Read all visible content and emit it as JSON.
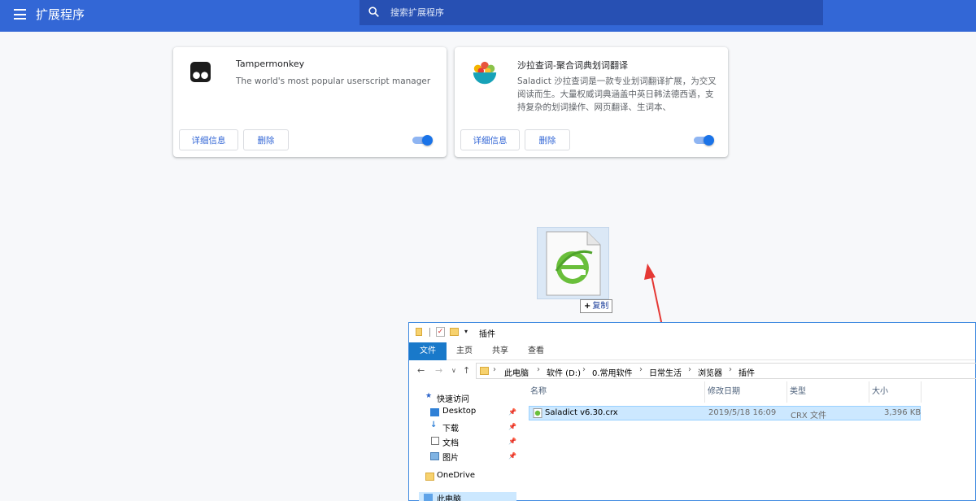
{
  "header": {
    "title": "扩展程序",
    "search_placeholder": "搜索扩展程序"
  },
  "extensions": [
    {
      "name": "Tampermonkey",
      "description": "The world's most popular userscript manager",
      "details_label": "详细信息",
      "remove_label": "删除",
      "enabled": true,
      "icon": "tampermonkey-icon"
    },
    {
      "name": "沙拉查词-聚合词典划词翻译",
      "description": "Saladict 沙拉查词是一款专业划词翻译扩展，为交叉阅读而生。大量权威词典涵盖中英日韩法德西语，支持复杂的划词操作、网页翻译、生词本、",
      "details_label": "详细信息",
      "remove_label": "删除",
      "enabled": true,
      "icon": "saladict-icon"
    }
  ],
  "drag": {
    "badge_label": "复制",
    "file_icon": "crx-file-icon"
  },
  "explorer": {
    "title": "插件",
    "ribbon_tabs": [
      "文件",
      "主页",
      "共享",
      "查看"
    ],
    "breadcrumb": [
      "此电脑",
      "软件 (D:)",
      "0.常用软件",
      "日常生活",
      "浏览器",
      "插件"
    ],
    "nav": {
      "quick_access": "快速访问",
      "items": [
        "Desktop",
        "下载",
        "文档",
        "图片"
      ],
      "onedrive": "OneDrive",
      "this_pc": "此电脑"
    },
    "columns": [
      "名称",
      "修改日期",
      "类型",
      "大小"
    ],
    "files": [
      {
        "name": "Saladict v6.30.crx",
        "modified": "2019/5/18 16:09",
        "type": "CRX 文件",
        "size": "3,396 KB"
      }
    ]
  },
  "colors": {
    "header_bg": "#3367d6",
    "accent": "#1a73e8",
    "arrow": "#e53935"
  }
}
